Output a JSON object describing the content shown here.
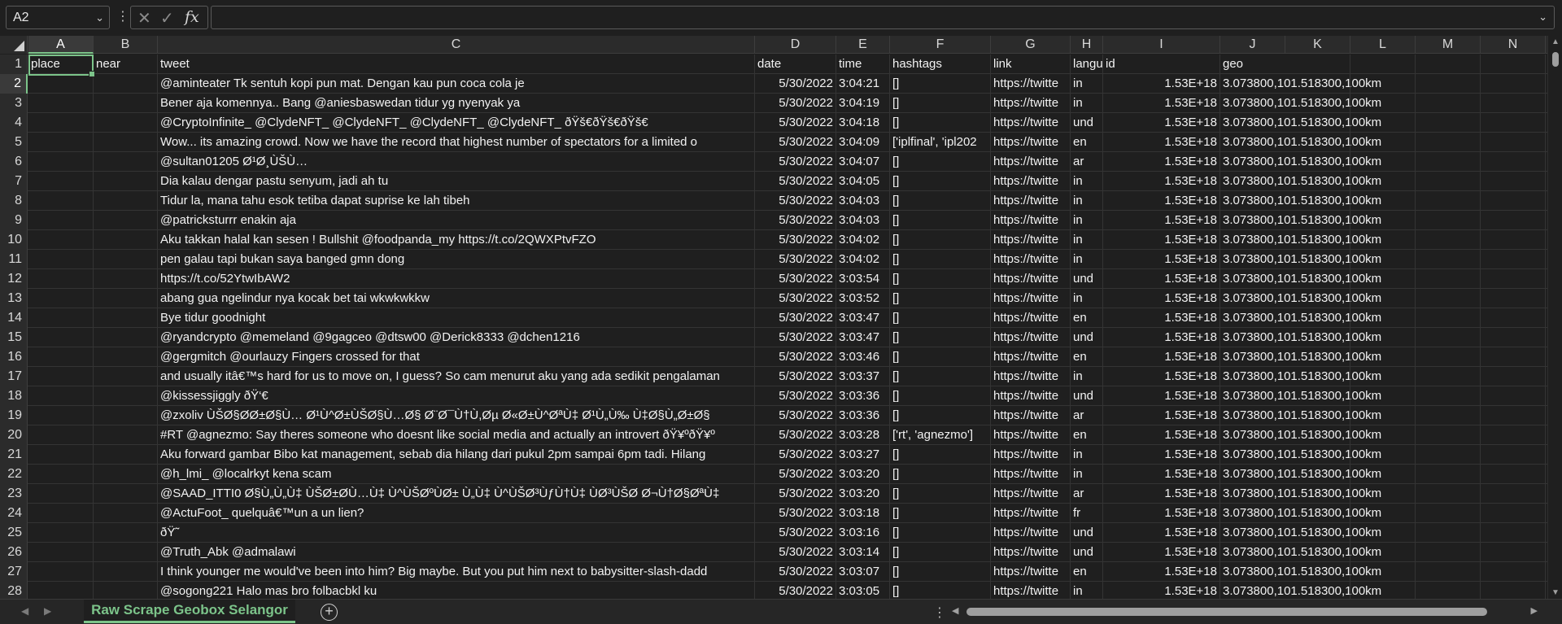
{
  "formula_bar": {
    "name_box": "A2",
    "formula": "",
    "cancel_icon": "close-icon",
    "enter_icon": "check-icon",
    "function_label": "fx"
  },
  "columns": [
    "A",
    "B",
    "C",
    "D",
    "E",
    "F",
    "G",
    "H",
    "I",
    "J",
    "K",
    "L",
    "M",
    "N"
  ],
  "selected_column": "A",
  "selected_row": "2",
  "rows": [
    {
      "n": "1",
      "place": "place",
      "near": "near",
      "tweet": "tweet",
      "date": "date",
      "time": "time",
      "hashtags": "hashtags",
      "link": "link",
      "lang": "langu",
      "id": "id",
      "geo": "geo",
      "header": true
    },
    {
      "n": "2",
      "place": "",
      "near": "",
      "tweet": "@aminteater Tk sentuh kopi pun mat. Dengan kau pun coca cola je",
      "date": "5/30/2022",
      "time": "3:04:21",
      "hashtags": "[]",
      "link": "https://twitte",
      "lang": "in",
      "id": "1.53E+18",
      "geo": "3.073800,101.518300,100km"
    },
    {
      "n": "3",
      "place": "",
      "near": "",
      "tweet": "Bener aja komennya..  Bang @aniesbaswedan tidur yg nyenyak ya",
      "date": "5/30/2022",
      "time": "3:04:19",
      "hashtags": "[]",
      "link": "https://twitte",
      "lang": "in",
      "id": "1.53E+18",
      "geo": "3.073800,101.518300,100km"
    },
    {
      "n": "4",
      "place": "",
      "near": "",
      "tweet": "@CryptoInfinite_ @ClydeNFT_ @ClydeNFT_ @ClydeNFT_ @ClydeNFT_  ðŸš€ðŸš€ðŸš€",
      "date": "5/30/2022",
      "time": "3:04:18",
      "hashtags": "[]",
      "link": "https://twitte",
      "lang": "und",
      "id": "1.53E+18",
      "geo": "3.073800,101.518300,100km"
    },
    {
      "n": "5",
      "place": "",
      "near": "",
      "tweet": "Wow... its amazing crowd. Now we have the record that highest number of spectators for a limited o",
      "date": "5/30/2022",
      "time": "3:04:09",
      "hashtags": "['iplfinal', 'ipl202",
      "link": "https://twitte",
      "lang": "en",
      "id": "1.53E+18",
      "geo": "3.073800,101.518300,100km"
    },
    {
      "n": "6",
      "place": "",
      "near": "",
      "tweet": "@sultan01205 Ø¹Ø¸ÙŠÙ…",
      "date": "5/30/2022",
      "time": "3:04:07",
      "hashtags": "[]",
      "link": "https://twitte",
      "lang": "ar",
      "id": "1.53E+18",
      "geo": "3.073800,101.518300,100km"
    },
    {
      "n": "7",
      "place": "",
      "near": "",
      "tweet": "Dia kalau dengar pastu senyum, jadi ah tu",
      "date": "5/30/2022",
      "time": "3:04:05",
      "hashtags": "[]",
      "link": "https://twitte",
      "lang": "in",
      "id": "1.53E+18",
      "geo": "3.073800,101.518300,100km"
    },
    {
      "n": "8",
      "place": "",
      "near": "",
      "tweet": "Tidur la, mana tahu esok tetiba dapat suprise ke lah tibeh",
      "date": "5/30/2022",
      "time": "3:04:03",
      "hashtags": "[]",
      "link": "https://twitte",
      "lang": "in",
      "id": "1.53E+18",
      "geo": "3.073800,101.518300,100km"
    },
    {
      "n": "9",
      "place": "",
      "near": "",
      "tweet": "@patricksturrr enakin aja",
      "date": "5/30/2022",
      "time": "3:04:03",
      "hashtags": "[]",
      "link": "https://twitte",
      "lang": "in",
      "id": "1.53E+18",
      "geo": "3.073800,101.518300,100km"
    },
    {
      "n": "10",
      "place": "",
      "near": "",
      "tweet": "Aku takkan halal kan sesen ! Bullshit @foodpanda_my  https://t.co/2QWXPtvFZO",
      "date": "5/30/2022",
      "time": "3:04:02",
      "hashtags": "[]",
      "link": "https://twitte",
      "lang": "in",
      "id": "1.53E+18",
      "geo": "3.073800,101.518300,100km"
    },
    {
      "n": "11",
      "place": "",
      "near": "",
      "tweet": "pen galau tapi bukan saya banged gmn dong",
      "date": "5/30/2022",
      "time": "3:04:02",
      "hashtags": "[]",
      "link": "https://twitte",
      "lang": "in",
      "id": "1.53E+18",
      "geo": "3.073800,101.518300,100km"
    },
    {
      "n": "12",
      "place": "",
      "near": "",
      "tweet": " https://t.co/52YtwIbAW2",
      "date": "5/30/2022",
      "time": "3:03:54",
      "hashtags": "[]",
      "link": "https://twitte",
      "lang": "und",
      "id": "1.53E+18",
      "geo": "3.073800,101.518300,100km"
    },
    {
      "n": "13",
      "place": "",
      "near": "",
      "tweet": "abang gua ngelindur nya kocak bet tai wkwkwkkw",
      "date": "5/30/2022",
      "time": "3:03:52",
      "hashtags": "[]",
      "link": "https://twitte",
      "lang": "in",
      "id": "1.53E+18",
      "geo": "3.073800,101.518300,100km"
    },
    {
      "n": "14",
      "place": "",
      "near": "",
      "tweet": "Bye tidur goodnight",
      "date": "5/30/2022",
      "time": "3:03:47",
      "hashtags": "[]",
      "link": "https://twitte",
      "lang": "en",
      "id": "1.53E+18",
      "geo": "3.073800,101.518300,100km"
    },
    {
      "n": "15",
      "place": "",
      "near": "",
      "tweet": "@ryandcrypto @memeland @9gagceo @dtsw00 @Derick8333 @dchen1216",
      "date": "5/30/2022",
      "time": "3:03:47",
      "hashtags": "[]",
      "link": "https://twitte",
      "lang": "und",
      "id": "1.53E+18",
      "geo": "3.073800,101.518300,100km"
    },
    {
      "n": "16",
      "place": "",
      "near": "",
      "tweet": "@gergmitch @ourlauzy Fingers crossed for that",
      "date": "5/30/2022",
      "time": "3:03:46",
      "hashtags": "[]",
      "link": "https://twitte",
      "lang": "en",
      "id": "1.53E+18",
      "geo": "3.073800,101.518300,100km"
    },
    {
      "n": "17",
      "place": "",
      "near": "",
      "tweet": "and usually itâ€™s hard for us to move on, I guess? So cam menurut aku yang ada sedikit pengalaman",
      "date": "5/30/2022",
      "time": "3:03:37",
      "hashtags": "[]",
      "link": "https://twitte",
      "lang": "in",
      "id": "1.53E+18",
      "geo": "3.073800,101.518300,100km"
    },
    {
      "n": "18",
      "place": "",
      "near": "",
      "tweet": "@kissessjiggly ðŸ‘€",
      "date": "5/30/2022",
      "time": "3:03:36",
      "hashtags": "[]",
      "link": "https://twitte",
      "lang": "und",
      "id": "1.53E+18",
      "geo": "3.073800,101.518300,100km"
    },
    {
      "n": "19",
      "place": "",
      "near": "",
      "tweet": "@zxoliv ÙŠØ§Ø­Ø±Ø§Ù… Ø¹Ù^Ø±ÙŠØ§Ù…Ø§ Ø¨Ø¯Ù†Ù,Øµ Ø«Ø±Ù^ØªÙ‡ Ø¹Ù„Ù‰ Ù‡Ø§Ù„Ø±Ø§",
      "date": "5/30/2022",
      "time": "3:03:36",
      "hashtags": "[]",
      "link": "https://twitte",
      "lang": "ar",
      "id": "1.53E+18",
      "geo": "3.073800,101.518300,100km"
    },
    {
      "n": "20",
      "place": "",
      "near": "",
      "tweet": "#RT @agnezmo: Say theres someone who doesnt like social media and actually an introvert ðŸ¥ºðŸ¥º",
      "date": "5/30/2022",
      "time": "3:03:28",
      "hashtags": "['rt', 'agnezmo']",
      "link": "https://twitte",
      "lang": "en",
      "id": "1.53E+18",
      "geo": "3.073800,101.518300,100km"
    },
    {
      "n": "21",
      "place": "",
      "near": "",
      "tweet": "Aku forward gambar Bibo kat management, sebab dia hilang dari pukul 2pm sampai 6pm tadi. Hilang",
      "date": "5/30/2022",
      "time": "3:03:27",
      "hashtags": "[]",
      "link": "https://twitte",
      "lang": "in",
      "id": "1.53E+18",
      "geo": "3.073800,101.518300,100km"
    },
    {
      "n": "22",
      "place": "",
      "near": "",
      "tweet": "@h_lmi_ @localrkyt kena scam",
      "date": "5/30/2022",
      "time": "3:03:20",
      "hashtags": "[]",
      "link": "https://twitte",
      "lang": "in",
      "id": "1.53E+18",
      "geo": "3.073800,101.518300,100km"
    },
    {
      "n": "23",
      "place": "",
      "near": "",
      "tweet": "@SAAD_ITTI0 Ø§Ù„Ù„Ù‡ ÙŠØ±Ø­Ù…Ù‡ Ù^ÙŠØºÙØ± Ù„Ù‡ Ù^ÙŠØ³ÙƒÙ†Ù‡ ÙØ³ÙŠØ­ Ø¬Ù†Ø§ØªÙ‡",
      "date": "5/30/2022",
      "time": "3:03:20",
      "hashtags": "[]",
      "link": "https://twitte",
      "lang": "ar",
      "id": "1.53E+18",
      "geo": "3.073800,101.518300,100km"
    },
    {
      "n": "24",
      "place": "",
      "near": "",
      "tweet": "@ActuFoot_ quelquâ€™un a un lien?",
      "date": "5/30/2022",
      "time": "3:03:18",
      "hashtags": "[]",
      "link": "https://twitte",
      "lang": "fr",
      "id": "1.53E+18",
      "geo": "3.073800,101.518300,100km"
    },
    {
      "n": "25",
      "place": "",
      "near": "",
      "tweet": "ðŸ˜­",
      "date": "5/30/2022",
      "time": "3:03:16",
      "hashtags": "[]",
      "link": "https://twitte",
      "lang": "und",
      "id": "1.53E+18",
      "geo": "3.073800,101.518300,100km"
    },
    {
      "n": "26",
      "place": "",
      "near": "",
      "tweet": "@Truth_Abk @admalawi",
      "date": "5/30/2022",
      "time": "3:03:14",
      "hashtags": "[]",
      "link": "https://twitte",
      "lang": "und",
      "id": "1.53E+18",
      "geo": "3.073800,101.518300,100km"
    },
    {
      "n": "27",
      "place": "",
      "near": "",
      "tweet": "I think younger me would've been into him? Big maybe. But you put him next to babysitter-slash-dadd",
      "date": "5/30/2022",
      "time": "3:03:07",
      "hashtags": "[]",
      "link": "https://twitte",
      "lang": "en",
      "id": "1.53E+18",
      "geo": "3.073800,101.518300,100km"
    },
    {
      "n": "28",
      "place": "",
      "near": "",
      "tweet": "@sogong221 Halo mas bro folbacbkl ku",
      "date": "5/30/2022",
      "time": "3:03:05",
      "hashtags": "[]",
      "link": "https://twitte",
      "lang": "in",
      "id": "1.53E+18",
      "geo": "3.073800,101.518300,100km"
    }
  ],
  "sheet_tabs": [
    {
      "label": "Raw Scrape Geobox Selangor",
      "active": true
    }
  ],
  "icons": {
    "add_sheet": "plus-circle-icon",
    "prev_sheet": "chevron-left-icon",
    "next_sheet": "chevron-right-icon"
  },
  "colors": {
    "accent": "#7cc48a",
    "background": "#1f1f1f",
    "header": "#2b2b2b"
  }
}
